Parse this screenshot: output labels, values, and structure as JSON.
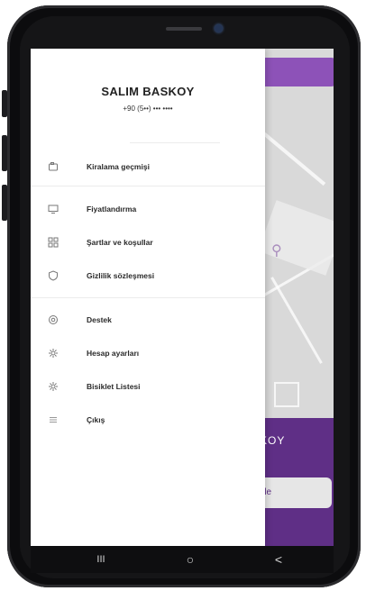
{
  "profile": {
    "name": "SALIM BASKOY",
    "phone": "+90 (5••) ••• ••••"
  },
  "menu": [
    {
      "label": "Kiralama geçmişi",
      "icon": "history-icon"
    },
    {
      "label": "Fiyatlandırma",
      "icon": "monitor-icon"
    },
    {
      "label": "Şartlar ve koşullar",
      "icon": "grid-icon"
    },
    {
      "label": "Gizlilik sözleşmesi",
      "icon": "shield-icon"
    },
    {
      "label": "Destek",
      "icon": "support-icon"
    },
    {
      "label": "Hesap ayarları",
      "icon": "gear-icon"
    },
    {
      "label": "Bisiklet Listesi",
      "icon": "gear-icon"
    },
    {
      "label": "Çıkış",
      "icon": "list-icon"
    }
  ],
  "background": {
    "panel_text": "KOY",
    "button_text": "de"
  },
  "nav": {
    "recents": "III",
    "home": "○",
    "back": "<"
  },
  "colors": {
    "accent": "#5f2f86",
    "accent_light": "#8d52b8"
  }
}
